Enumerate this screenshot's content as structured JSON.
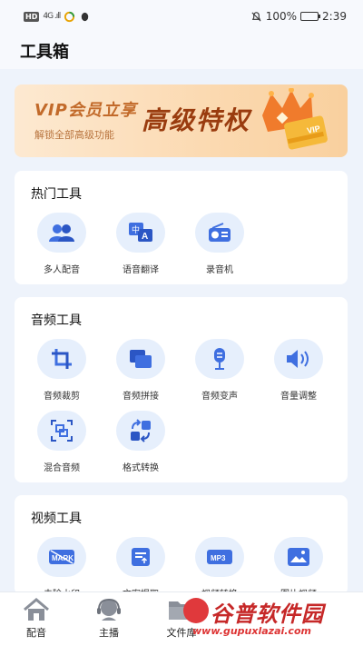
{
  "status_bar": {
    "hd_chip": "HD",
    "signal": "4G .ıll",
    "battery_percent": "100%",
    "time": "2:39",
    "battery_level": 1.0
  },
  "header": {
    "title": "工具箱"
  },
  "banner": {
    "vip_text": "VIP会员立享",
    "sub_text": "解锁全部高级功能",
    "big_text": "高级特权",
    "card_text": "VIP"
  },
  "hot_tools": {
    "title": "热门工具",
    "items": [
      {
        "label": "多人配音",
        "icon": "people-icon"
      },
      {
        "label": "语音翻译",
        "icon": "translate-icon"
      },
      {
        "label": "录音机",
        "icon": "radio-icon"
      }
    ]
  },
  "audio_tools": {
    "title": "音频工具",
    "items": [
      {
        "label": "音频裁剪",
        "icon": "crop-icon"
      },
      {
        "label": "音频拼接",
        "icon": "merge-icon"
      },
      {
        "label": "音频变声",
        "icon": "microphone-icon"
      },
      {
        "label": "音量调整",
        "icon": "volume-icon"
      },
      {
        "label": "混合音频",
        "icon": "mix-icon"
      },
      {
        "label": "格式转换",
        "icon": "convert-icon"
      }
    ]
  },
  "video_tools": {
    "title": "视频工具",
    "items": [
      {
        "label": "去除水印",
        "icon": "watermark-icon",
        "badge": "MARK"
      },
      {
        "label": "文案提取",
        "icon": "text-extract-icon"
      },
      {
        "label": "视频转换",
        "icon": "mp3-icon",
        "badge": "MP3"
      },
      {
        "label": "图片视频",
        "icon": "image-icon"
      }
    ]
  },
  "tabbar": {
    "items": [
      {
        "label": "配音",
        "icon": "home-icon"
      },
      {
        "label": "主播",
        "icon": "headset-icon"
      },
      {
        "label": "文件库",
        "icon": "folder-icon"
      }
    ]
  },
  "watermark": {
    "main": "谷普软件园",
    "url": "www.gupuxlazai.com"
  },
  "colors": {
    "accent": "#3f6fe0",
    "icon_bg": "#e6effc",
    "page_bg": "#eef3fb"
  }
}
